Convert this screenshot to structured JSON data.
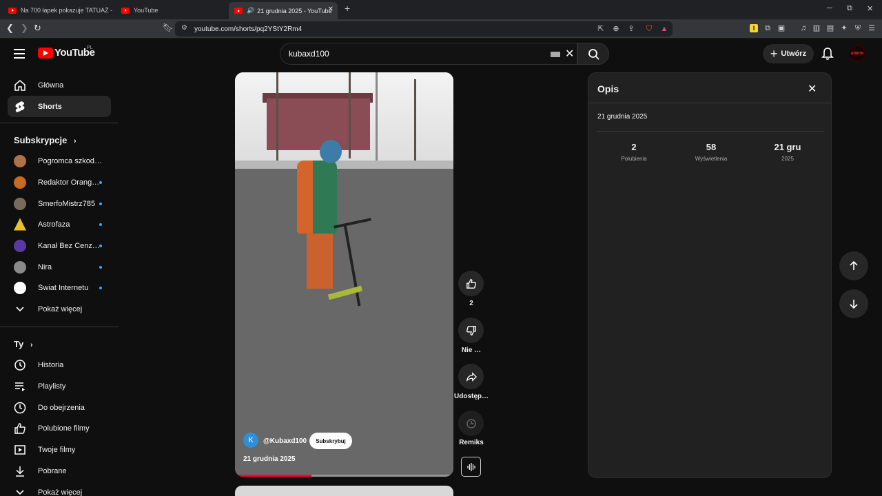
{
  "browser": {
    "tabs": [
      {
        "title": "Na 700 łapek pokazuje TATUAŻ - You"
      },
      {
        "title": "YouTube"
      },
      {
        "title": "21 grudnia 2025 - YouTube"
      }
    ],
    "url": "youtube.com/shorts/pq2YStY2Rm4",
    "new_tab": "+",
    "win_min": "─",
    "win_max": "⧉",
    "win_close": "✕"
  },
  "header": {
    "logo_text": "YouTube",
    "logo_region": "PL",
    "search_value": "kubaxd100",
    "create_label": "Utwórz",
    "avatar_text": "ADRON"
  },
  "sidebar": {
    "main": [
      {
        "label": "Główna",
        "icon": "home-icon"
      },
      {
        "label": "Shorts",
        "icon": "shorts-icon"
      }
    ],
    "subs_header": "Subskrypcje",
    "subs": [
      {
        "label": "Pogromca szkodni…",
        "color": "#b07048",
        "dot": false
      },
      {
        "label": "Redaktor Orangu…",
        "color": "#c86a20",
        "dot": true
      },
      {
        "label": "SmerfoMistrz785",
        "color": "#7a6a5a",
        "dot": true
      },
      {
        "label": "Astrofaza",
        "color": "#e8c030",
        "dot": true
      },
      {
        "label": "Kanał Bez Cenzu…",
        "color": "#5a3aa0",
        "dot": true
      },
      {
        "label": "Nira",
        "color": "#8a8a8a",
        "dot": true
      },
      {
        "label": "Świat Internetu",
        "color": "#ffffff",
        "dot": true
      }
    ],
    "show_more": "Pokaż więcej",
    "you_header": "Ty",
    "you": [
      {
        "label": "Historia",
        "icon": "history-icon"
      },
      {
        "label": "Playlisty",
        "icon": "playlist-icon"
      },
      {
        "label": "Do obejrzenia",
        "icon": "watch-later-icon"
      },
      {
        "label": "Polubione filmy",
        "icon": "like-icon"
      },
      {
        "label": "Twoje filmy",
        "icon": "your-videos-icon"
      },
      {
        "label": "Pobrane",
        "icon": "download-icon"
      },
      {
        "label": "Pokaż więcej",
        "icon": "chevron-down-icon"
      }
    ]
  },
  "video": {
    "channel_initial": "K",
    "channel": "@Kubaxd100",
    "subscribe": "Subskrybuj",
    "date": "21 grudnia 2025",
    "progress": 0.35
  },
  "actions": {
    "likes": "2",
    "dislike": "Nie …",
    "share": "Udostęp…",
    "remix": "Remiks"
  },
  "panel": {
    "title": "Opis",
    "date": "21 grudnia 2025",
    "stats": [
      {
        "value": "2",
        "label": "Polubienia"
      },
      {
        "value": "58",
        "label": "Wyświetlenia"
      },
      {
        "value": "21 gru",
        "label": "2025"
      }
    ]
  }
}
